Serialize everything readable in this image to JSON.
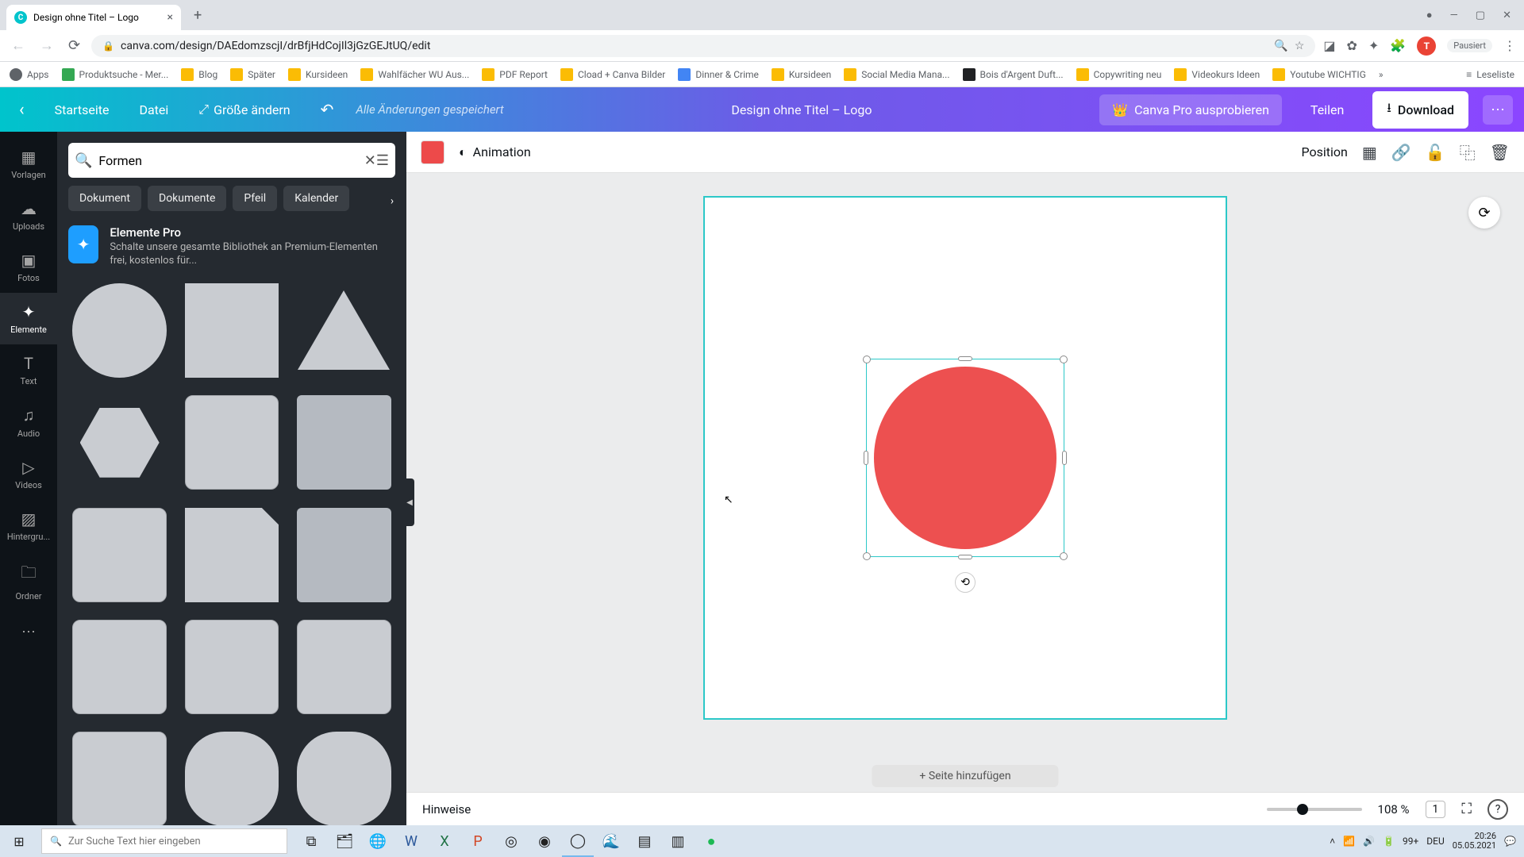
{
  "browser": {
    "tab_title": "Design ohne Titel – Logo",
    "url": "canva.com/design/DAEdomzscjI/drBfjHdCojIl3jGzGEJtUQ/edit",
    "profile_initial": "T",
    "paused_label": "Pausiert",
    "bookmarks": [
      "Apps",
      "Produktsuche - Mer...",
      "Blog",
      "Später",
      "Kursideen",
      "Wahlfächer WU Aus...",
      "PDF Report",
      "Cload + Canva Bilder",
      "Dinner & Crime",
      "Kursideen",
      "Social Media Mana...",
      "Bois d'Argent Duft...",
      "Copywriting neu",
      "Videokurs Ideen",
      "Youtube WICHTIG"
    ],
    "reading_list": "Leseliste"
  },
  "header": {
    "home": "Startseite",
    "file": "Datei",
    "resize": "Größe ändern",
    "saved": "Alle Änderungen gespeichert",
    "title": "Design ohne Titel – Logo",
    "try_pro": "Canva Pro ausprobieren",
    "share": "Teilen",
    "download": "Download"
  },
  "leftnav": {
    "items": [
      {
        "label": "Vorlagen",
        "icon": "▦"
      },
      {
        "label": "Uploads",
        "icon": "☁"
      },
      {
        "label": "Fotos",
        "icon": "▣"
      },
      {
        "label": "Elemente",
        "icon": "✦"
      },
      {
        "label": "Text",
        "icon": "T"
      },
      {
        "label": "Audio",
        "icon": "♫"
      },
      {
        "label": "Videos",
        "icon": "▷"
      },
      {
        "label": "Hintergru...",
        "icon": "▨"
      },
      {
        "label": "Ordner",
        "icon": "🗀"
      }
    ]
  },
  "sidepanel": {
    "search_value": "Formen",
    "chips": [
      "Dokument",
      "Dokumente",
      "Pfeil",
      "Kalender"
    ],
    "pro": {
      "title": "Elemente Pro",
      "desc": "Schalte unsere gesamte Bibliothek an Premium-Elementen frei, kostenlos für..."
    }
  },
  "context_toolbar": {
    "animation": "Animation",
    "position": "Position",
    "color": "#ed4a4a"
  },
  "canvas": {
    "add_page": "+ Seite hinzufügen",
    "shape_color": "#ed5050"
  },
  "footer": {
    "hints": "Hinweise",
    "zoom": "108 %",
    "page": "1"
  },
  "taskbar": {
    "search_placeholder": "Zur Suche Text hier eingeben",
    "lang": "DEU",
    "time": "20:26",
    "date": "05.05.2021",
    "notif": "99+"
  }
}
